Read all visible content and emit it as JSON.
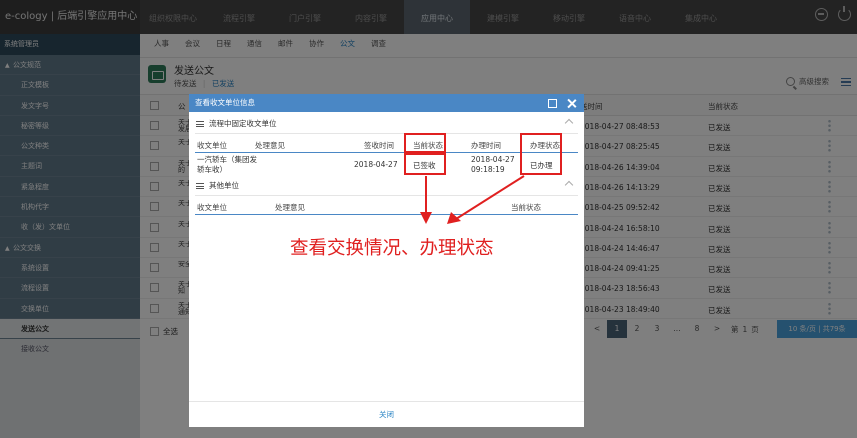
{
  "header": {
    "logo": "e-cology | 后端引擎应用中心"
  },
  "topnav": [
    "组织权限中心",
    "流程引擎",
    "门户引擎",
    "内容引擎",
    "应用中心",
    "建模引擎",
    "移动引擎",
    "语音中心",
    "集成中心"
  ],
  "topnav_active": "应用中心",
  "sidebar": {
    "user": "系统管理员",
    "items": [
      {
        "label": "公文规范",
        "level": 0
      },
      {
        "label": "正文模板",
        "level": 1
      },
      {
        "label": "发文字号",
        "level": 1
      },
      {
        "label": "秘密等级",
        "level": 1
      },
      {
        "label": "公文种类",
        "level": 1
      },
      {
        "label": "主题词",
        "level": 1
      },
      {
        "label": "紧急程度",
        "level": 1
      },
      {
        "label": "机构代字",
        "level": 1
      },
      {
        "label": "收（发）文单位",
        "level": 1
      },
      {
        "label": "公文交换",
        "level": 0
      },
      {
        "label": "系统设置",
        "level": 1
      },
      {
        "label": "流程设置",
        "level": 1
      },
      {
        "label": "交换单位",
        "level": 1
      },
      {
        "label": "发送公文",
        "level": 1,
        "active": true
      },
      {
        "label": "接收公文",
        "level": 1
      }
    ]
  },
  "subnav": [
    "人事",
    "会议",
    "日程",
    "通信",
    "邮件",
    "协作",
    "公文",
    "调查"
  ],
  "subnav_active": "公文",
  "page": {
    "title": "发送公文",
    "tab_pending": "待发送",
    "separator": "|",
    "tab_sent": "已发送",
    "search_label": "高级搜索",
    "col_title": "公",
    "col_time": "送时间",
    "col_status": "当前状态"
  },
  "rows": [
    {
      "title": "关于发展",
      "time": "2018-04-27 08:48:53",
      "status": "已发送"
    },
    {
      "title": "关于",
      "time": "2018-04-27 08:25:45",
      "status": "已发送"
    },
    {
      "title": "关于的",
      "time": "2018-04-26 14:39:04",
      "status": "已发送"
    },
    {
      "title": "关于",
      "time": "2018-04-26 14:13:29",
      "status": "已发送"
    },
    {
      "title": "关于",
      "time": "2018-04-25 09:52:42",
      "status": "已发送"
    },
    {
      "title": "关于",
      "time": "2018-04-24 16:58:10",
      "status": "已发送"
    },
    {
      "title": "关于",
      "time": "2018-04-24 14:46:47",
      "status": "已发送"
    },
    {
      "title": "安全",
      "time": "2018-04-24 09:41:25",
      "status": "已发送"
    },
    {
      "title": "关于知",
      "time": "2018-04-23 18:56:43",
      "status": "已发送"
    },
    {
      "title": "关于通知",
      "time": "2018-04-23 18:49:40",
      "status": "已发送"
    }
  ],
  "footer": {
    "select_all": "全选",
    "prev": "<",
    "pages": [
      "1",
      "2",
      "3",
      "...",
      "8"
    ],
    "next": ">",
    "goto_prefix": "第",
    "goto_page": "1",
    "goto_suffix": "页",
    "per_page": "10 条/页 | 共79条"
  },
  "modal": {
    "title": "查看收文单位信息",
    "section1": "流程中固定收文单位",
    "section2": "其他单位",
    "cols1": {
      "unit": "收文单位",
      "opinion": "处理意见",
      "sign_time": "签收时间",
      "status": "当前状态",
      "handle_time": "办理时间",
      "handle_status": "办理状态"
    },
    "row1": {
      "unit": "一汽轿车（集团发轿车收）",
      "sign_time": "2018-04-27",
      "status": "已签收",
      "handle_time": "2018-04-27 09:18:19",
      "handle_status": "已办理"
    },
    "cols2": {
      "unit": "收文单位",
      "opinion": "处理意见",
      "status": "当前状态"
    },
    "close": "关闭"
  },
  "annotation": {
    "text": "查看交换情况、办理状态",
    "color": "#e02020"
  },
  "colors": {
    "accent": "#2a84c4",
    "sidebar": "#617a8b",
    "modal_header": "#4a87c5"
  }
}
